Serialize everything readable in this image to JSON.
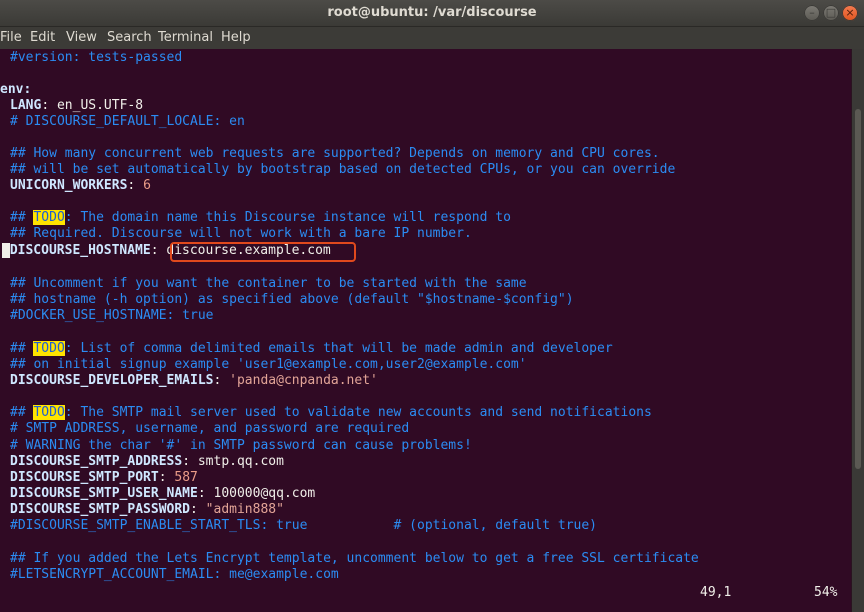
{
  "window": {
    "title": "root@ubuntu: /var/discourse"
  },
  "menu": [
    "File",
    "Edit",
    "View",
    "Search",
    "Terminal",
    "Help"
  ],
  "todo": "TODO",
  "lines": {
    "l0": "#version: tests-passed",
    "l2": "env:",
    "l3k": "LANG",
    "l3v": " en_US.UTF-8",
    "l4": "# DISCOURSE_DEFAULT_LOCALE: en",
    "l6": "## How many concurrent web requests are supported? Depends on memory and CPU cores.",
    "l7": "## will be set automatically by bootstrap based on detected CPUs, or you can override",
    "l8k": "UNICORN_WORKERS",
    "l8v": "6",
    "l10a": "## ",
    "l10b": ": The domain name this Discourse instance will respond to",
    "l11": "## Required. Discourse will not work with a bare IP number.",
    "l12k": "DISCOURSE_HOSTNAME",
    "l12v": "discourse.example.com",
    "l14": "## Uncomment if you want the container to be started with the same",
    "l15": "## hostname (-h option) as specified above (default \"$hostname-$config\")",
    "l16": "#DOCKER_USE_HOSTNAME: true",
    "l18a": "## ",
    "l18b": ": List of comma delimited emails that will be made admin and developer",
    "l19": "## on initial signup example 'user1@example.com,user2@example.com'",
    "l20k": "DISCOURSE_DEVELOPER_EMAILS",
    "l20v": "'panda@cnpanda.net'",
    "l22a": "## ",
    "l22b": ": The SMTP mail server used to validate new accounts and send notifications",
    "l23": "# SMTP ADDRESS, username, and password are required",
    "l24": "# WARNING the char '#' in SMTP password can cause problems!",
    "l25k": "DISCOURSE_SMTP_ADDRESS",
    "l25v": "smtp.qq.com",
    "l26k": "DISCOURSE_SMTP_PORT",
    "l26v": "587",
    "l27k": "DISCOURSE_SMTP_USER_NAME",
    "l27v": "100000@qq.com",
    "l28k": "DISCOURSE_SMTP_PASSWORD",
    "l28v": "\"admin888\"",
    "l29": "#DISCOURSE_SMTP_ENABLE_START_TLS: true           # (optional, default true)",
    "l31": "## If you added the Lets Encrypt template, uncomment below to get a free SSL certificate",
    "l32": "#LETSENCRYPT_ACCOUNT_EMAIL: me@example.com"
  },
  "status": {
    "position": "49,1",
    "percent": "54%"
  }
}
